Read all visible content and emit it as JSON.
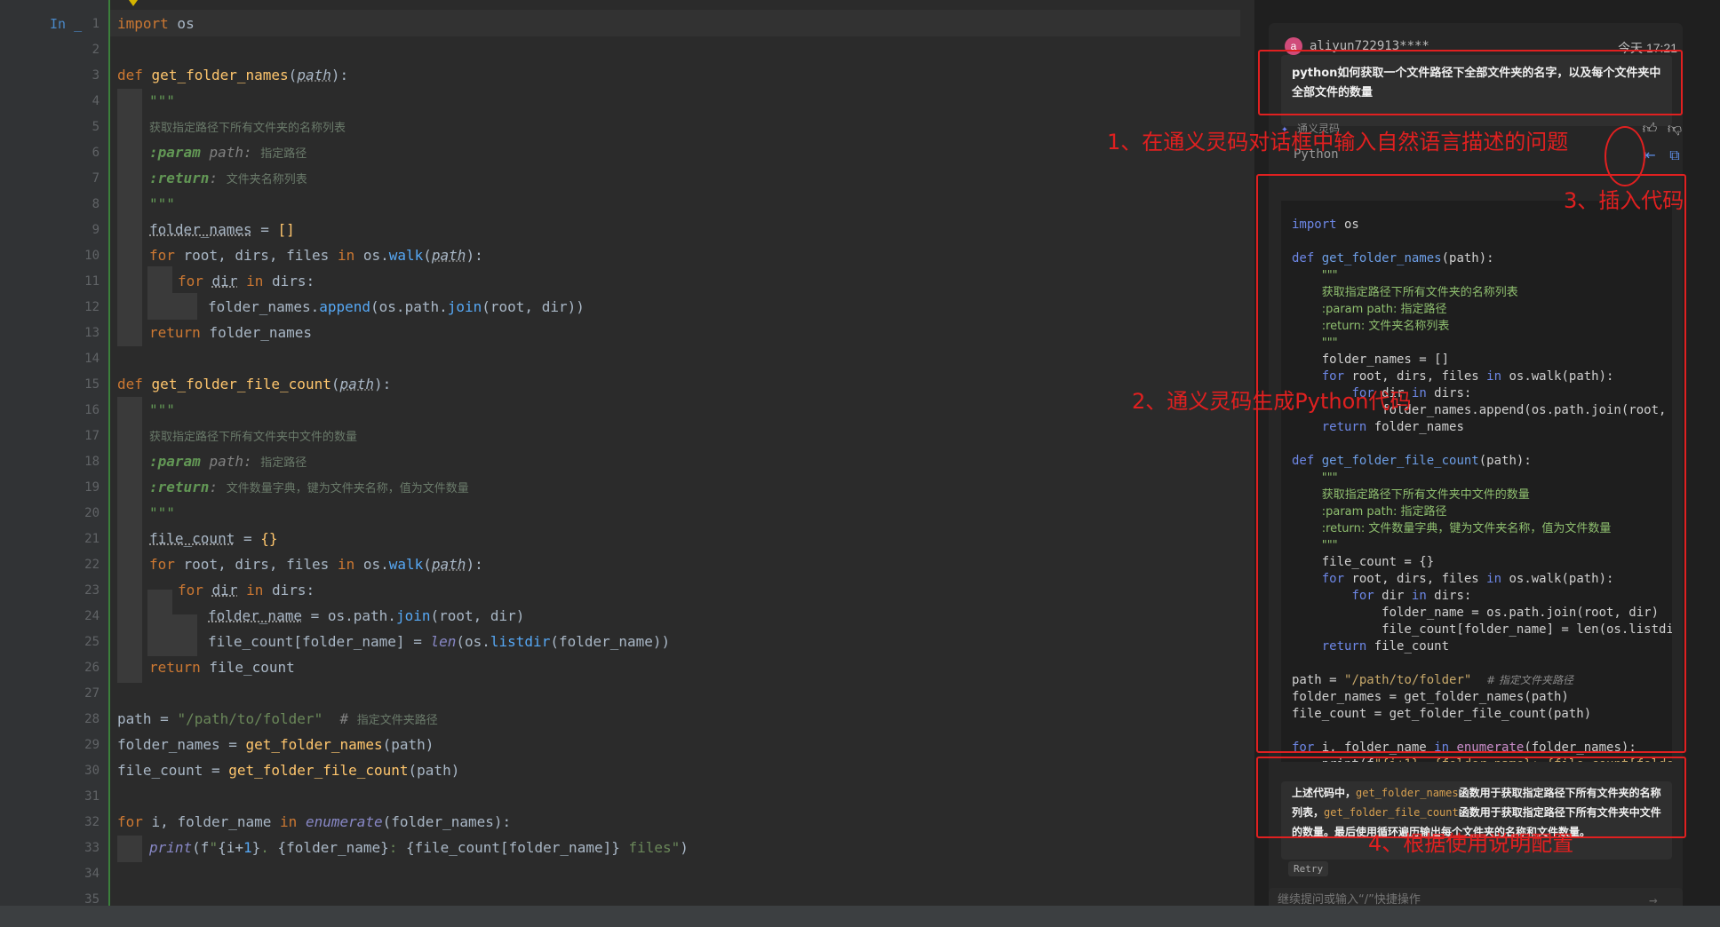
{
  "editor": {
    "exec_marker": "In _",
    "line_numbers": [
      "1",
      "2",
      "3",
      "4",
      "5",
      "6",
      "7",
      "8",
      "9",
      "10",
      "11",
      "12",
      "13",
      "14",
      "15",
      "16",
      "17",
      "18",
      "19",
      "20",
      "21",
      "22",
      "23",
      "24",
      "25",
      "26",
      "27",
      "28",
      "29",
      "30",
      "31",
      "32",
      "33",
      "34",
      "35"
    ]
  },
  "assistant": {
    "username": "aliyun722913****",
    "avatar_letter": "a",
    "timestamp": "今天 17:21",
    "question": "python如何获取一个文件路径下全部文件夹的名字，以及每个文件夹中全部文件的数量",
    "ai_name": "通义灵码",
    "code_lang": "Python",
    "explain_prefix": "上述代码中，",
    "explain_fn1": "get_folder_names",
    "explain_mid1": "函数用于获取指定路径下所有文件夹的名称列表，",
    "explain_fn2": "get_folder_file_count",
    "explain_mid2": "函数用于获取指定路径下所有文件夹中文件的数量。最后使用循环遍历输出每个文件夹的名称和文件数量。",
    "retry_label": "Retry",
    "input_placeholder": "继续提问或输入“/”快捷操作"
  },
  "annotations": {
    "step1": "1、在通义灵码对话框中输入自然语言描述的问题",
    "step2": "2、通义灵码生成Python代码",
    "step3": "3、插入代码",
    "step4": "4、根据使用说明配置"
  },
  "colors": {
    "annotation_red": "#e02020",
    "editor_bg": "#2b2b2b",
    "panel_bg": "#1f1f1f"
  },
  "icons": [
    "thumbs-up-icon",
    "thumbs-down-icon",
    "insert-code-icon",
    "copy-icon",
    "send-icon",
    "settings-icon",
    "ai-logo-icon"
  ]
}
